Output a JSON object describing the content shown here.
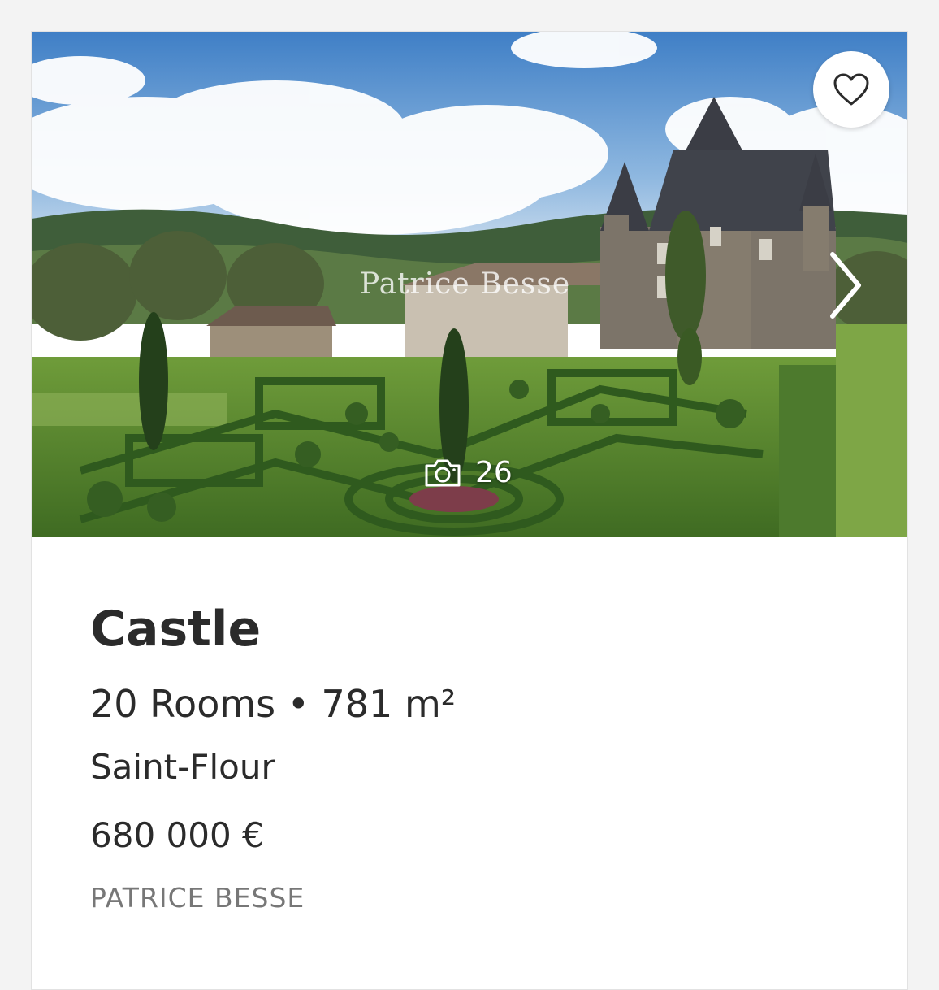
{
  "listing": {
    "photo": {
      "watermark": "Patrice Besse",
      "photo_count": "26",
      "favorite_icon": "heart-outline-icon",
      "next_icon": "chevron-right-icon",
      "camera_icon": "camera-icon"
    },
    "title": "Castle",
    "rooms": "20 Rooms",
    "separator": "•",
    "area": "781 m²",
    "location": "Saint-Flour",
    "price": "680 000 €",
    "agency": "PATRICE BESSE"
  },
  "colors": {
    "text": "#2b2b2b",
    "muted": "#777777",
    "background": "#f3f3f3",
    "card": "#ffffff"
  }
}
